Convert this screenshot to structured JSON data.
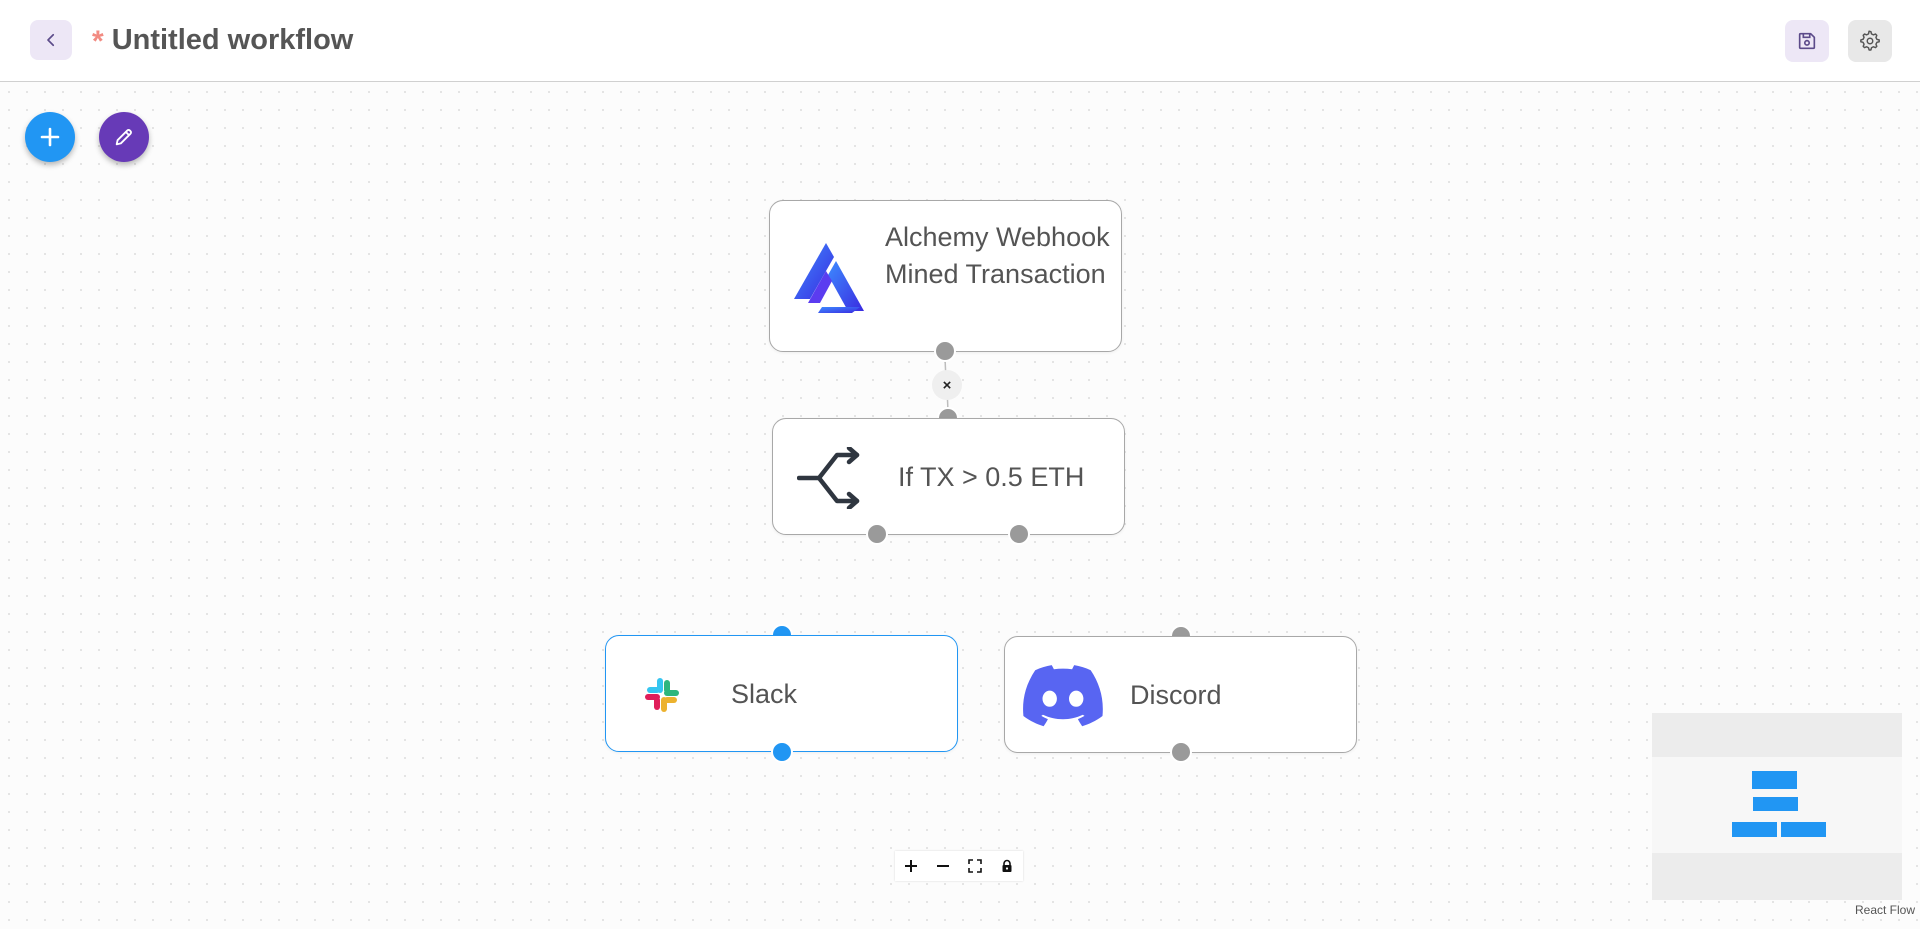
{
  "header": {
    "unsaved_marker": "*",
    "title": "Untitled workflow"
  },
  "nodes": {
    "alchemy": {
      "label": "Alchemy Webhook Mined Transaction"
    },
    "ifelse": {
      "label": "If TX > 0.5 ETH"
    },
    "slack": {
      "label": "Slack"
    },
    "discord": {
      "label": "Discord"
    }
  },
  "edge": {
    "delete_label": "×"
  },
  "icons": {
    "back": "chevron-left-icon",
    "save": "floppy-disk-icon",
    "settings": "gear-icon",
    "add": "plus-icon",
    "edit": "pencil-icon"
  },
  "colors": {
    "primary_blue": "#2196f3",
    "purple": "#673ab7",
    "unsaved_star": "#f28b82",
    "handle_gray": "#9a9a9a"
  },
  "attribution": "React Flow"
}
